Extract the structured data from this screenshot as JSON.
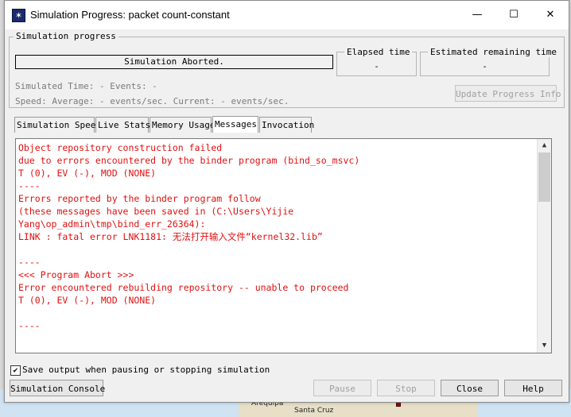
{
  "window": {
    "title": "Simulation Progress: packet count-constant",
    "icon": "simulation-star-icon",
    "minimize_glyph": "—",
    "maximize_glyph": "☐",
    "close_glyph": "✕"
  },
  "progress": {
    "group_title": "Simulation progress",
    "status": "Simulation Aborted.",
    "elapsed_title": "Elapsed time",
    "elapsed_value": "-",
    "remaining_title": "Estimated remaining time",
    "remaining_value": "-",
    "simulated_line": "Simulated Time: - Events: -",
    "speed_line": "Speed: Average: - events/sec. Current: - events/sec.",
    "update_button": "Update Progress Info"
  },
  "tabs": [
    {
      "label": "Simulation Speed",
      "active": false
    },
    {
      "label": "Live Stats",
      "active": false
    },
    {
      "label": "Memory Usage",
      "active": false
    },
    {
      "label": "Messages",
      "active": true
    },
    {
      "label": "Invocation",
      "active": false
    }
  ],
  "messages": [
    "Object repository construction failed",
    "due to errors encountered by the binder program (bind_so_msvc)",
    "T (0), EV (-), MOD (NONE)",
    "----",
    "Errors reported by the binder program follow",
    "(these messages have been saved in (C:\\Users\\Yijie",
    "Yang\\op_admin\\tmp\\bind_err_26364):",
    "LINK : fatal error LNK1181: 无法打开输入文件“kernel32.lib”",
    "",
    "----",
    "<<< Program Abort >>>",
    "Error encountered rebuilding repository -- unable to proceed",
    "T (0), EV (-), MOD (NONE)",
    "",
    "----"
  ],
  "options": {
    "save_output_label": "Save output when pausing or stopping simulation",
    "save_output_checked": true
  },
  "buttons": {
    "console": "Simulation Console",
    "pause": "Pause",
    "stop": "Stop",
    "close": "Close",
    "help": "Help"
  },
  "background_map": {
    "label1": "Arequipa",
    "label2": "Santa Cruz"
  },
  "colors": {
    "message_text": "#e01010",
    "disabled_text": "#9c9c9c"
  }
}
